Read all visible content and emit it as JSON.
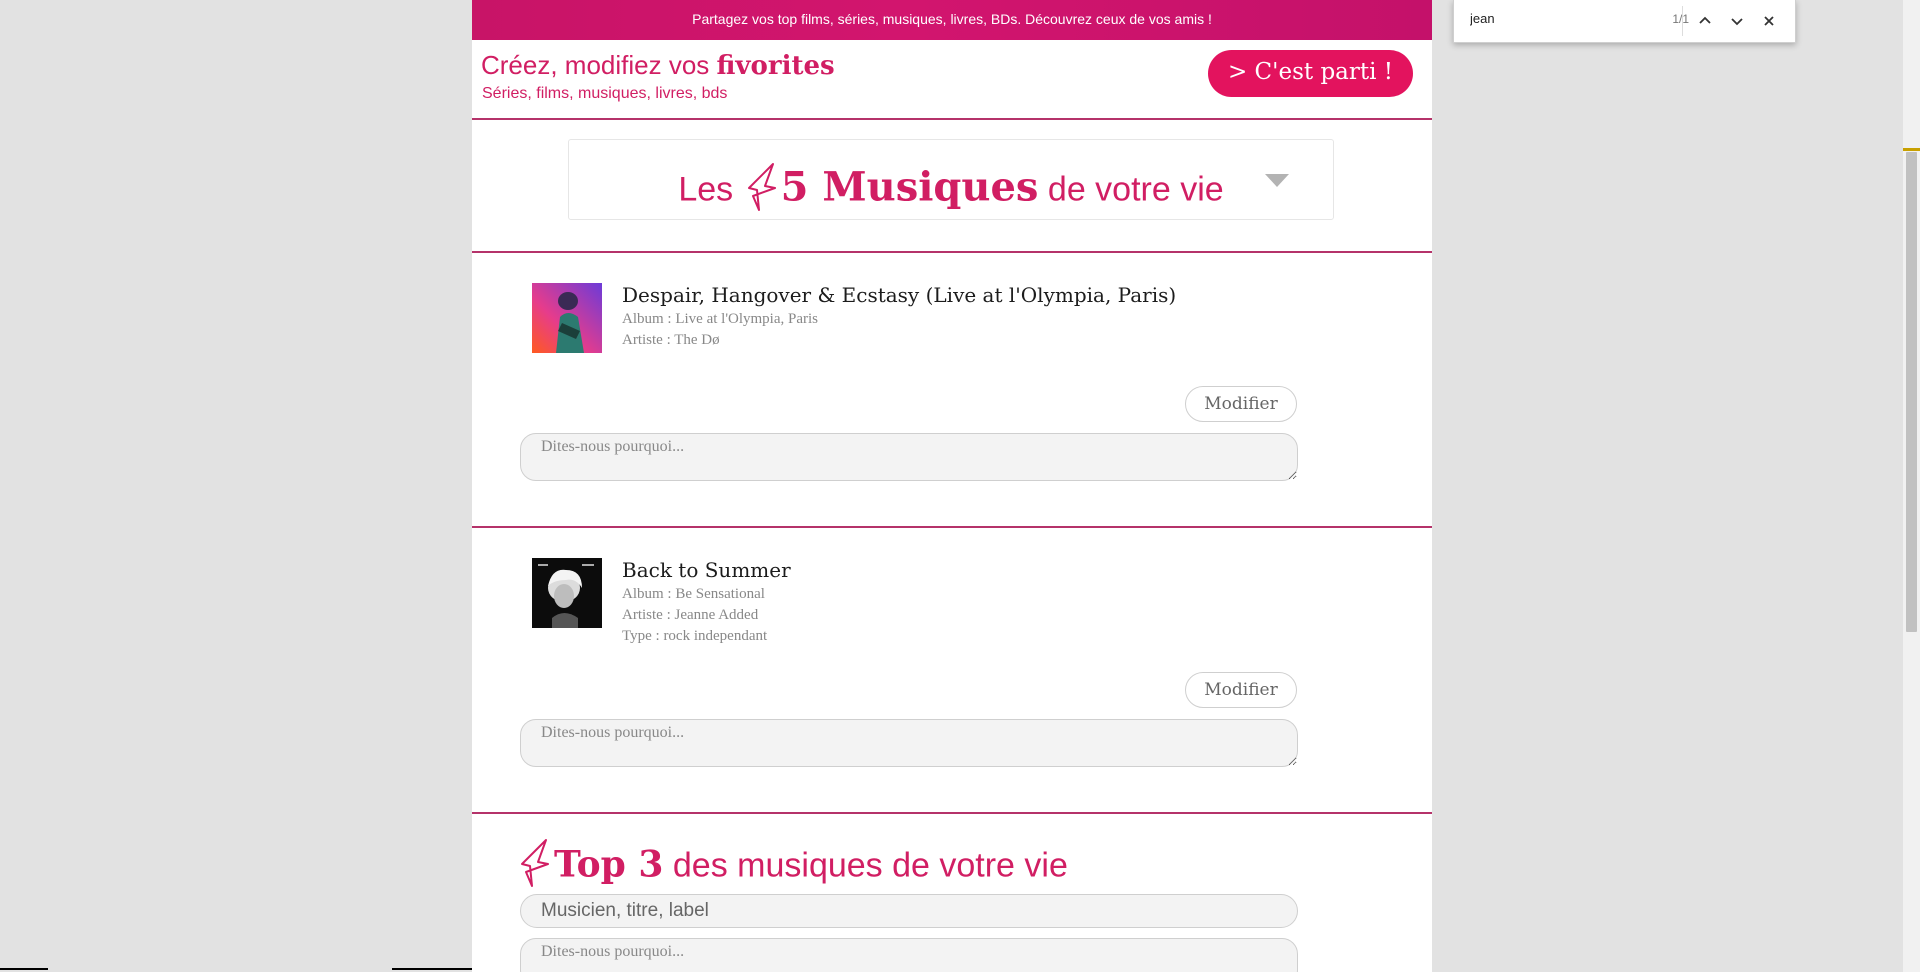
{
  "banner": {
    "text": "Partagez vos top films, séries, musiques, livres, BDs. Découvrez ceux de vos amis !"
  },
  "brand": {
    "line1_prefix": "Créez, modifiez vos ",
    "line1_bold": "fivorites",
    "line2": "Séries, films, musiques, livres, bds",
    "cta_label": "> C'est parti !"
  },
  "section_selector": {
    "prefix": "Les",
    "emphasis": "5 Musiques",
    "suffix": "de votre vie"
  },
  "items": [
    {
      "title": "Despair, Hangover & Ecstasy (Live at l'Olympia, Paris)",
      "album": "Album : Live at l'Olympia, Paris",
      "artist": "Artiste : The Dø",
      "modify_label": "Modifier",
      "why_placeholder": "Dites-nous pourquoi..."
    },
    {
      "title": "Back to Summer",
      "album": "Album : Be Sensational",
      "artist": "Artiste : Jeanne Added",
      "type": "Type : rock independant",
      "modify_label": "Modifier",
      "why_placeholder": "Dites-nous pourquoi..."
    }
  ],
  "top3": {
    "emphasis": "Top 3",
    "suffix": "des musiques de votre vie",
    "search_placeholder": "Musicien, titre, label",
    "why_placeholder": "Dites-nous pourquoi..."
  },
  "find_bar": {
    "query": "jean",
    "match_count": "1/1"
  },
  "colors": {
    "accent": "#d11e63",
    "banner": "#c81467",
    "divider": "#b5336a",
    "cta": "#e3135e"
  }
}
